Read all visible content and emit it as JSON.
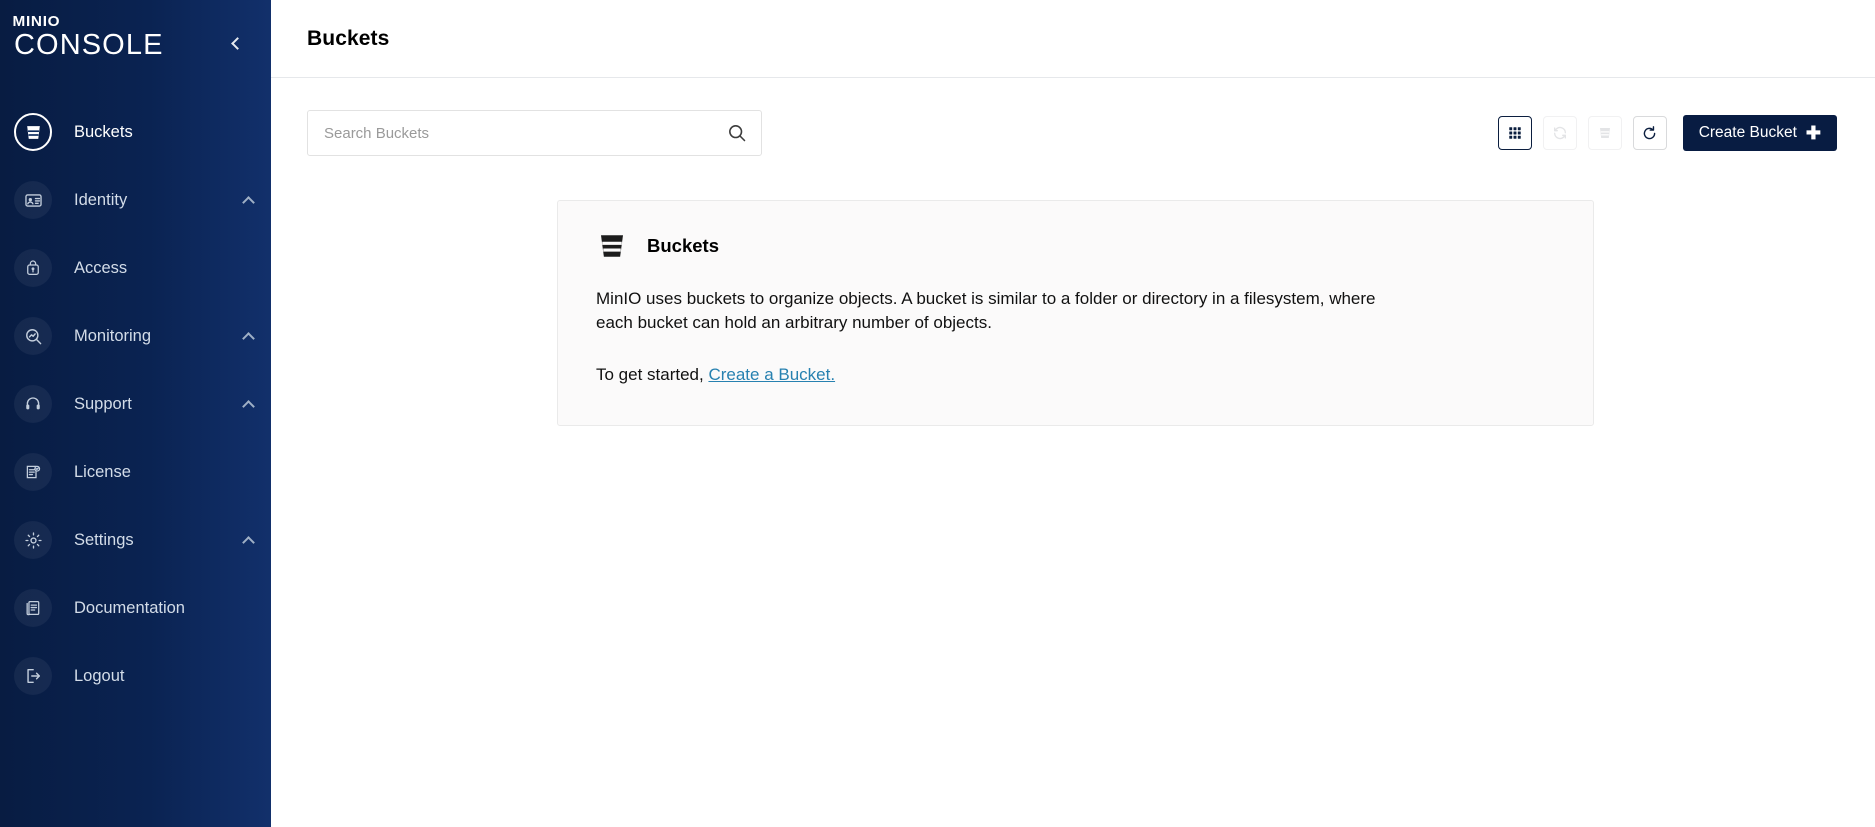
{
  "brand": {
    "logo_top": "MINIO",
    "logo_bottom": "CONSOLE",
    "collapse_icon": "chevron-left-icon"
  },
  "sidebar": {
    "items": [
      {
        "label": "Buckets",
        "icon": "bucket-icon",
        "active": true,
        "expandable": false
      },
      {
        "label": "Identity",
        "icon": "id-card-icon",
        "active": false,
        "expandable": true
      },
      {
        "label": "Access",
        "icon": "lock-icon",
        "active": false,
        "expandable": false
      },
      {
        "label": "Monitoring",
        "icon": "search-chart-icon",
        "active": false,
        "expandable": true
      },
      {
        "label": "Support",
        "icon": "headset-icon",
        "active": false,
        "expandable": true
      },
      {
        "label": "License",
        "icon": "certificate-icon",
        "active": false,
        "expandable": false
      },
      {
        "label": "Settings",
        "icon": "gear-icon",
        "active": false,
        "expandable": true
      },
      {
        "label": "Documentation",
        "icon": "book-icon",
        "active": false,
        "expandable": false
      },
      {
        "label": "Logout",
        "icon": "logout-icon",
        "active": false,
        "expandable": false
      }
    ]
  },
  "header": {
    "title": "Buckets"
  },
  "toolbar": {
    "search": {
      "placeholder": "Search Buckets",
      "value": ""
    },
    "buttons": [
      {
        "name": "grid-view-button",
        "icon": "grid-icon",
        "enabled": true,
        "label": ""
      },
      {
        "name": "refresh2-button",
        "icon": "sync-icon",
        "enabled": false,
        "label": ""
      },
      {
        "name": "delete-button",
        "icon": "delete-icon",
        "enabled": false,
        "label": ""
      },
      {
        "name": "refresh-button",
        "icon": "refresh-icon",
        "enabled": true,
        "label": ""
      }
    ],
    "create_button": {
      "label": "Create Bucket",
      "icon": "plus-icon"
    }
  },
  "card": {
    "icon": "bucket-icon",
    "title": "Buckets",
    "paragraph": "MinIO uses buckets to organize objects. A bucket is similar to a folder or directory in a filesystem, where each bucket can hold an arbitrary number of objects.",
    "cta_prefix": "To get started, ",
    "cta_link": "Create a Bucket."
  },
  "colors": {
    "sidebar_start": "#081C42",
    "sidebar_end": "#12306B",
    "accent_link": "#2781B0",
    "button_primary": "#081C42",
    "card_bg": "#FBFAFA"
  }
}
